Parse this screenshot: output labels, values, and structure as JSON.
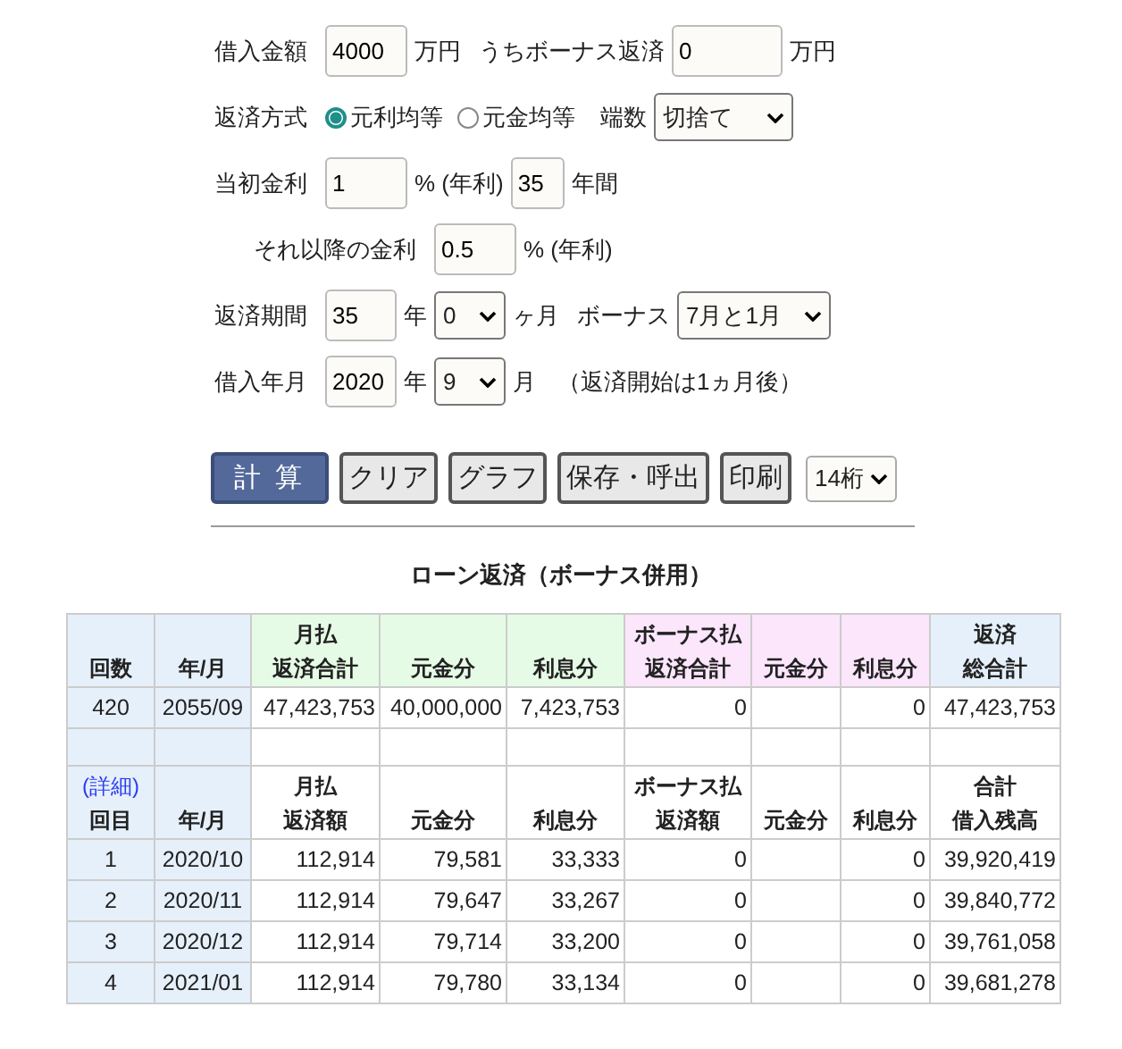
{
  "form": {
    "loan_amount": {
      "label": "借入金額",
      "value": "4000",
      "unit": "万円"
    },
    "bonus_part": {
      "label": "うちボーナス返済",
      "value": "0",
      "unit": "万円"
    },
    "method": {
      "label": "返済方式",
      "options": [
        {
          "label": "元利均等",
          "selected": true
        },
        {
          "label": "元金均等",
          "selected": false
        }
      ]
    },
    "rounding": {
      "label": "端数",
      "value": "切捨て"
    },
    "initial_rate": {
      "label": "当初金利",
      "value": "1",
      "unit": "% (年利)"
    },
    "initial_years": {
      "value": "35",
      "unit": "年間"
    },
    "later_rate": {
      "label": "それ以降の金利",
      "value": "0.5",
      "unit": "% (年利)"
    },
    "period": {
      "label": "返済期間",
      "years": "35",
      "year_unit": "年",
      "months": "0",
      "month_unit": "ヶ月"
    },
    "bonus_months": {
      "label": "ボーナス",
      "value": "7月と1月"
    },
    "start": {
      "label": "借入年月",
      "year": "2020",
      "year_unit": "年",
      "month": "9",
      "month_unit": "月",
      "note": "（返済開始は1ヵ月後）"
    }
  },
  "buttons": [
    {
      "label": "計 算",
      "kind": "primary"
    },
    {
      "label": "クリア",
      "kind": "normal"
    },
    {
      "label": "グラフ",
      "kind": "normal"
    },
    {
      "label": "保存・呼出",
      "kind": "normal"
    },
    {
      "label": "印刷",
      "kind": "normal"
    }
  ],
  "digits": {
    "value": "14桁"
  },
  "table": {
    "title": "ローン返済（ボーナス併用）",
    "summary_columns": [
      {
        "lines": [
          "回数"
        ],
        "color": "#e6f0fb"
      },
      {
        "lines": [
          "年/月"
        ],
        "color": "#e6f0fb"
      },
      {
        "lines": [
          "月払",
          "返済合計"
        ],
        "color": "#e6fbe6"
      },
      {
        "lines": [
          "元金分"
        ],
        "color": "#e6fbe6"
      },
      {
        "lines": [
          "利息分"
        ],
        "color": "#e6fbe6"
      },
      {
        "lines": [
          "ボーナス払",
          "返済合計"
        ],
        "color": "#fbe6fb"
      },
      {
        "lines": [
          "元金分"
        ],
        "color": "#fbe6fb"
      },
      {
        "lines": [
          "利息分"
        ],
        "color": "#fbe6fb"
      },
      {
        "lines": [
          "返済",
          "総合計"
        ],
        "color": "#e6f0fb"
      }
    ],
    "summary_row": {
      "count": "420",
      "month": "2055/09",
      "monthly_total": "47,423,753",
      "monthly_principal": "40,000,000",
      "monthly_interest": "7,423,753",
      "bonus_total": "0",
      "bonus_interest": "0",
      "grand_total": "47,423,753"
    },
    "detail_link": "(詳細)",
    "detail_columns": [
      {
        "lines": [
          "回目"
        ],
        "color": "#e6f0fb"
      },
      {
        "lines": [
          "年/月"
        ],
        "color": "#e6f0fb"
      },
      {
        "lines": [
          "月払",
          "返済額"
        ],
        "color": "#ffffff"
      },
      {
        "lines": [
          "元金分"
        ],
        "color": "#ffffff"
      },
      {
        "lines": [
          "利息分"
        ],
        "color": "#ffffff"
      },
      {
        "lines": [
          "ボーナス払",
          "返済額"
        ],
        "color": "#ffffff"
      },
      {
        "lines": [
          "元金分"
        ],
        "color": "#ffffff"
      },
      {
        "lines": [
          "利息分"
        ],
        "color": "#ffffff"
      },
      {
        "lines": [
          "合計",
          "借入残高"
        ],
        "color": "#ffffff"
      }
    ],
    "rows": [
      {
        "count": "1",
        "month": "2020/10",
        "monthly_total": "112,914",
        "monthly_principal": "79,581",
        "monthly_interest": "33,333",
        "bonus_total": "0",
        "bonus_interest": "0",
        "grand_total": "39,920,419"
      },
      {
        "count": "2",
        "month": "2020/11",
        "monthly_total": "112,914",
        "monthly_principal": "79,647",
        "monthly_interest": "33,267",
        "bonus_total": "0",
        "bonus_interest": "0",
        "grand_total": "39,840,772"
      },
      {
        "count": "3",
        "month": "2020/12",
        "monthly_total": "112,914",
        "monthly_principal": "79,714",
        "monthly_interest": "33,200",
        "bonus_total": "0",
        "bonus_interest": "0",
        "grand_total": "39,761,058"
      },
      {
        "count": "4",
        "month": "2021/01",
        "monthly_total": "112,914",
        "monthly_principal": "79,780",
        "monthly_interest": "33,134",
        "bonus_total": "0",
        "bonus_interest": "0",
        "grand_total": "39,681,278"
      }
    ]
  }
}
